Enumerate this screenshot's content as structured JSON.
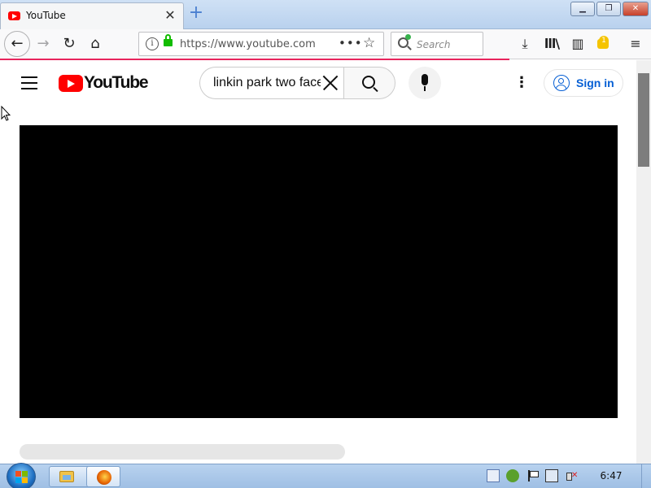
{
  "browser": {
    "tab": {
      "title": "YouTube",
      "close_glyph": "✕"
    },
    "new_tab_glyph": "+",
    "window_controls": {
      "minimize": "▁",
      "maximize": "❐",
      "close": "✕"
    },
    "nav": {
      "back_glyph": "←",
      "forward_glyph": "→",
      "reload_glyph": "↻",
      "home_glyph": "⌂"
    },
    "url": {
      "text": "https://www.youtube.com",
      "more_glyph": "•••",
      "bookmark_glyph": "☆"
    },
    "search": {
      "placeholder": "Search"
    },
    "toolbar": {
      "download_glyph": "⤓",
      "library_glyph": "lll\\",
      "sidebar_glyph": "▥",
      "extension_badge": "1",
      "menu_glyph": "≡"
    },
    "colors": {
      "loading_bar": "#e8245c",
      "lock": "#12bc00"
    }
  },
  "youtube": {
    "logo_text": "YouTube",
    "search_query": "linkin park two faces",
    "kebab_glyph": "⋮",
    "sign_in_label": "Sign in",
    "colors": {
      "brand_red": "#ff0000",
      "link_blue": "#065fd4"
    }
  },
  "player": {
    "state": "black-loading"
  },
  "taskbar": {
    "clock": "6:47",
    "pinned": [
      "explorer-icon",
      "firefox-icon"
    ],
    "tray": [
      "document-icon",
      "shield-icon",
      "flag-icon",
      "network-icon",
      "volume-muted-icon"
    ]
  }
}
